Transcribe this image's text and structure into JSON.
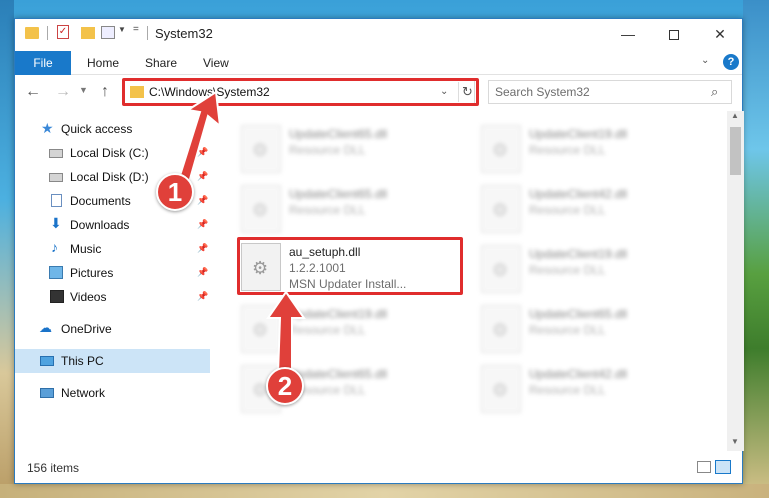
{
  "window": {
    "title": "System32",
    "min_label": "—",
    "close_label": "✕"
  },
  "ribbon": {
    "file": "File",
    "home": "Home",
    "share": "Share",
    "view": "View",
    "help": "?"
  },
  "nav": {
    "back": "←",
    "forward": "→",
    "up": "↑",
    "address": "C:\\Windows\\System32",
    "search_placeholder": "Search System32"
  },
  "sidebar": {
    "items": [
      {
        "label": "Quick access",
        "icon": "star-icon"
      },
      {
        "label": "Local Disk (C:)",
        "icon": "disk-icon"
      },
      {
        "label": "Local Disk (D:)",
        "icon": "disk-icon"
      },
      {
        "label": "Documents",
        "icon": "documents-icon"
      },
      {
        "label": "Downloads",
        "icon": "downloads-icon"
      },
      {
        "label": "Music",
        "icon": "music-icon"
      },
      {
        "label": "Pictures",
        "icon": "pictures-icon"
      },
      {
        "label": "Videos",
        "icon": "videos-icon"
      },
      {
        "label": "OneDrive",
        "icon": "cloud-icon"
      },
      {
        "label": "This PC",
        "icon": "pc-icon"
      },
      {
        "label": "Network",
        "icon": "network-icon"
      }
    ]
  },
  "files": {
    "left": [
      {
        "name": "UpdateClient65.dll",
        "sub": "Resource DLL"
      },
      {
        "name": "UpdateClient65.dll",
        "sub": "Resource DLL"
      },
      {
        "name": "au_setuph.dll",
        "version": "1.2.2.1001",
        "desc": "MSN Updater Install..."
      },
      {
        "name": "UpdateClient19.dll",
        "sub": "Resource DLL"
      },
      {
        "name": "UpdateClient65.dll",
        "sub": "Resource DLL"
      }
    ],
    "right": [
      {
        "name": "UpdateClient19.dll",
        "sub": "Resource DLL"
      },
      {
        "name": "UpdateClient42.dll",
        "sub": "Resource DLL"
      },
      {
        "name": "UpdateClient19.dll",
        "sub": "Resource DLL"
      },
      {
        "name": "UpdateClient65.dll",
        "sub": "Resource DLL"
      },
      {
        "name": "UpdateClient42.dll",
        "sub": "Resource DLL"
      }
    ]
  },
  "status": {
    "count": "156 items"
  },
  "annotations": {
    "step1": "1",
    "step2": "2",
    "color": "#e02d2d"
  },
  "colors": {
    "accent": "#1979ca",
    "selected": "#cce4f7"
  }
}
